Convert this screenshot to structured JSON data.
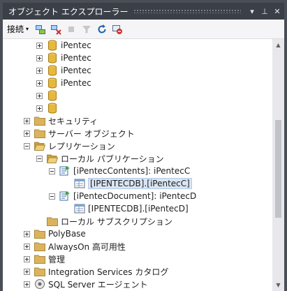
{
  "window": {
    "title": "オブジェクト エクスプローラー",
    "title_buttons": [
      "▾",
      "⊥",
      "✕"
    ]
  },
  "toolbar": {
    "connect_label": "接続",
    "connect_caret": "▾",
    "icons": [
      "connect-object-explorer-icon",
      "disconnect-icon",
      "stop-icon",
      "filter-icon",
      "refresh-icon",
      "activity-monitor-icon"
    ]
  },
  "tree": {
    "databases": [
      {
        "label": "iPentec",
        "expanded": false
      },
      {
        "label": "iPentec",
        "expanded": false
      },
      {
        "label": "iPentec",
        "expanded": false
      },
      {
        "label": "iPentec",
        "expanded": false
      },
      {
        "label": "",
        "expanded": false
      },
      {
        "label": "",
        "expanded": false
      }
    ],
    "security": "セキュリティ",
    "server_objects": "サーバー オブジェクト",
    "replication": "レプリケーション",
    "local_publications": "ローカル パブリケーション",
    "publication1": "[iPentecContents]: iPentecC",
    "subscription1": "[IPENTECDB].[iPentecC]",
    "publication2": "[iPentecDocument]: iPentecD",
    "subscription2": "[IPENTECDB].[iPentecD]",
    "local_subscriptions": "ローカル サブスクリプション",
    "polybase": "PolyBase",
    "alwayson": "AlwaysOn 高可用性",
    "management": "管理",
    "integration_services": "Integration Services カタログ",
    "sql_server_agent": "SQL Server エージェント"
  },
  "colors": {
    "title_bg": "#3b4048",
    "frame_bg": "#4a4f57",
    "toolbar_bg": "#f5f5f7",
    "tree_bg": "#ffffff",
    "folder": "#dcb35c",
    "database": "#e8b83a",
    "selection": "#d9e5f3"
  }
}
